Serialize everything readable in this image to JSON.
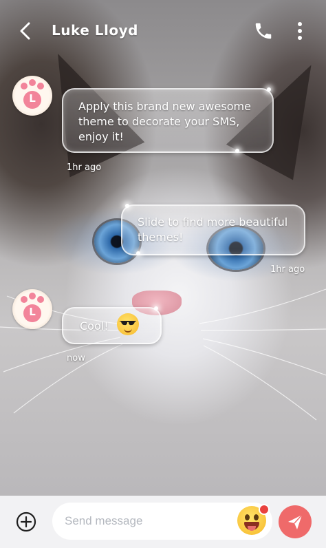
{
  "header": {
    "title": "Luke Lloyd",
    "back_icon": "chevron-left-icon",
    "call_icon": "phone-icon",
    "menu_icon": "more-vertical-icon"
  },
  "messages": [
    {
      "sender": "incoming",
      "avatar_letter": "L",
      "lines": [
        "Apply this brand new awesome",
        "theme to decorate your SMS,",
        "enjoy it!"
      ],
      "time": "1hr ago"
    },
    {
      "sender": "outgoing",
      "lines": [
        "Slide to find more beautiful",
        "themes!"
      ],
      "time": "1hr ago"
    },
    {
      "sender": "incoming",
      "avatar_letter": "L",
      "text": "Cool!",
      "emoji": "smiling-face-with-sunglasses",
      "time": "now"
    }
  ],
  "composer": {
    "add_icon": "plus-circle-icon",
    "placeholder": "Send message",
    "value": "",
    "emoji_icon": "grinning-face-icon",
    "send_icon": "paper-plane-icon"
  },
  "colors": {
    "send_button": "#ef6a6a",
    "avatar_paw": "#f2849a",
    "bottom_bar": "#f2f2f4",
    "emoji_badge": "#e9413e"
  }
}
